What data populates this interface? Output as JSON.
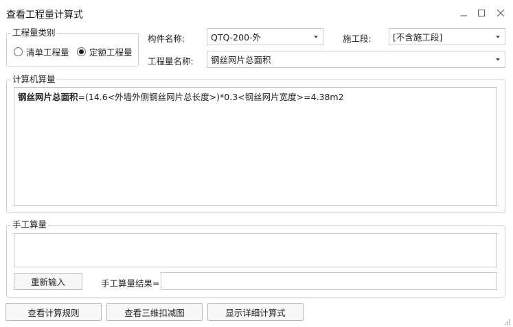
{
  "window": {
    "title": "查看工程量计算式"
  },
  "quantity_type": {
    "legend": "工程量类别",
    "options": [
      {
        "label": "清单工程量",
        "selected": false
      },
      {
        "label": "定额工程量",
        "selected": true
      }
    ]
  },
  "component": {
    "label": "构件名称:",
    "value": "QTQ-200-外"
  },
  "construction_section": {
    "label": "施工段:",
    "value": "[不含施工段]"
  },
  "quantity_name": {
    "label": "工程量名称:",
    "value": "钢丝网片总面积"
  },
  "computer_calc": {
    "legend": "计算机算量",
    "formula_name": "钢丝网片总面积",
    "formula_body": "=(14.6<外墙外侧钢丝网片总长度>)*0.3<钢丝网片宽度>=4.38m2"
  },
  "manual_calc": {
    "legend": "手工算量",
    "reenter_button": "重新输入",
    "result_label": "手工算量结果=",
    "result_value": ""
  },
  "footer": {
    "rules_button": "查看计算规则",
    "view3d_button": "查看三维扣减图",
    "detail_button": "显示详细计算式"
  }
}
